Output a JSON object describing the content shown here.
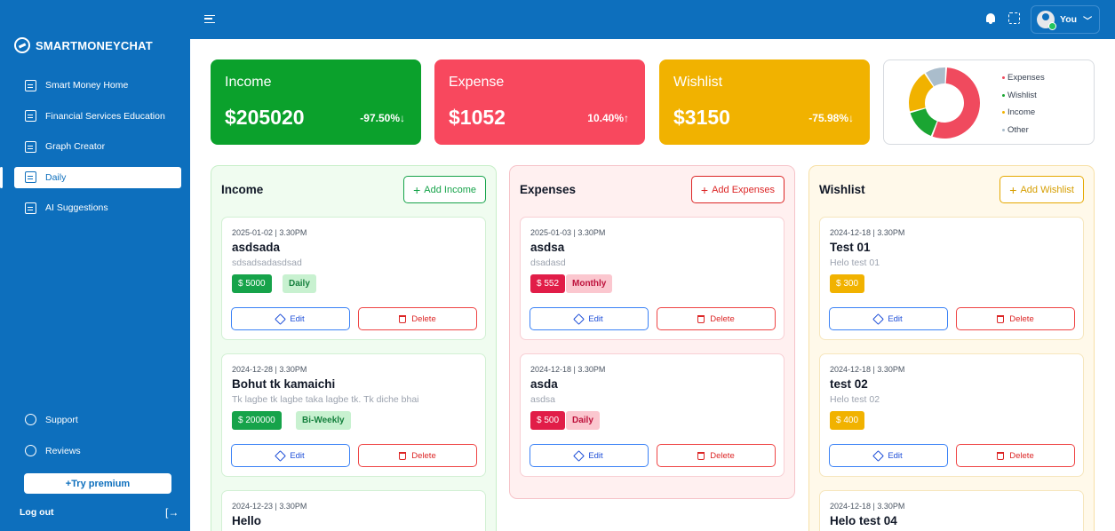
{
  "brand": {
    "name": "SMARTMONEYCHAT"
  },
  "sidebar": {
    "items": [
      {
        "label": "Smart Money Home"
      },
      {
        "label": "Financial Services Education"
      },
      {
        "label": "Graph Creator"
      },
      {
        "label": "Daily",
        "active": true
      },
      {
        "label": "AI Suggestions"
      }
    ],
    "support": "Support",
    "reviews": "Reviews",
    "premium": "+Try premium",
    "logout": "Log out",
    "logout_icon": "[→"
  },
  "topbar": {
    "user": "You",
    "chevron": "﹀"
  },
  "stats": {
    "income": {
      "title": "Income",
      "amount": "$205020",
      "pct": "-97.50%↓",
      "color": "#0ba12c"
    },
    "expense": {
      "title": "Expense",
      "amount": "$1052",
      "pct": "10.40%↑",
      "color": "#f8485e"
    },
    "wishlist": {
      "title": "Wishlist",
      "amount": "$3150",
      "pct": "-75.98%↓",
      "color": "#f1b200"
    }
  },
  "chart_data": {
    "type": "pie",
    "categories": [
      "Expenses",
      "Wishlist",
      "Income",
      "Other"
    ],
    "values": [
      55,
      15,
      20,
      10
    ],
    "colors": [
      "#f04a5e",
      "#1aa532",
      "#f1b200",
      "#aabdcc"
    ],
    "legend": "right"
  },
  "income_col": {
    "title": "Income",
    "add": "Add Income",
    "entries": [
      {
        "date": "2025-01-02 | 3.30PM",
        "name": "asdsada",
        "desc": "sdsadsadasdsad",
        "amount": "$ 5000",
        "freq": "Daily"
      },
      {
        "date": "2024-12-28 | 3.30PM",
        "name": "Bohut tk kamaichi",
        "desc": "Tk lagbe tk lagbe taka lagbe tk. Tk diche bhai",
        "amount": "$ 200000",
        "freq": "Bi-Weekly"
      },
      {
        "date": "2024-12-23 | 3.30PM",
        "name": "Hello"
      }
    ]
  },
  "expense_col": {
    "title": "Expenses",
    "add": "Add Expenses",
    "entries": [
      {
        "date": "2025-01-03 | 3.30PM",
        "name": "asdsa",
        "desc": "dsadasd",
        "amount": "$ 552",
        "freq": "Monthly"
      },
      {
        "date": "2024-12-18 | 3.30PM",
        "name": "asda",
        "desc": "asdsa",
        "amount": "$ 500",
        "freq": "Daily"
      }
    ]
  },
  "wish_col": {
    "title": "Wishlist",
    "add": "Add Wishlist",
    "entries": [
      {
        "date": "2024-12-18 | 3.30PM",
        "name": "Test 01",
        "desc": "Helo test 01",
        "amount": "$ 300"
      },
      {
        "date": "2024-12-18 | 3.30PM",
        "name": "test 02",
        "desc": "Helo test 02",
        "amount": "$ 400"
      },
      {
        "date": "2024-12-18 | 3.30PM",
        "name": "Helo test 04"
      }
    ]
  },
  "actions": {
    "edit": "Edit",
    "delete": "Delete",
    "plus": "+"
  }
}
